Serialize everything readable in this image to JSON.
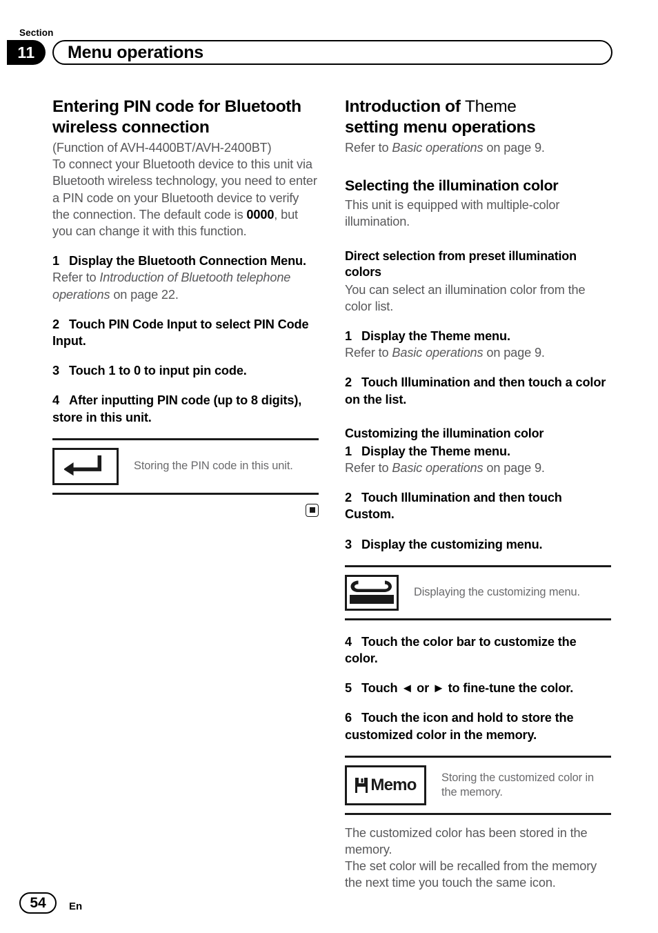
{
  "header": {
    "section_word": "Section",
    "section_number": "11",
    "title": "Menu operations"
  },
  "left_column": {
    "heading": "Entering PIN code for Bluetooth wireless connection",
    "intro_line1": "(Function of AVH-4400BT/AVH-2400BT)",
    "intro_line2_a": "To connect your Bluetooth device to this unit via Bluetooth wireless technology, you need to enter a PIN code on your Bluetooth device to verify the connection. The default code is ",
    "intro_bold": "0000",
    "intro_line2_b": ", but you can change it with this function.",
    "steps": [
      {
        "num": "1",
        "text": "Display the Bluetooth Connection Menu.",
        "ref_prefix": "Refer to ",
        "ref_italic": "Introduction of Bluetooth telephone operations",
        "ref_suffix": " on page 22."
      },
      {
        "num": "2",
        "text": "Touch PIN Code Input to select PIN Code Input."
      },
      {
        "num": "3",
        "text": "Touch 1 to 0 to input pin code."
      },
      {
        "num": "4",
        "text": "After inputting PIN code (up to 8 digits), store in this unit."
      }
    ],
    "note": {
      "icon": "enter-return-arrow-icon",
      "text": "Storing the PIN code in this unit."
    },
    "end_marker": "end-of-section-marker"
  },
  "right_column": {
    "heading_bold": "Introduction of ",
    "heading_regular": "Theme",
    "heading_line2": "setting menu operations",
    "heading_ref_prefix": "Refer to ",
    "heading_ref_italic": "Basic operations",
    "heading_ref_suffix": " on page 9.",
    "section1": {
      "heading": "Selecting the illumination color",
      "body": "This unit is equipped with multiple-color illumination."
    },
    "section2": {
      "heading": "Direct selection from preset illumination colors",
      "body": "You can select an illumination color from the color list.",
      "steps": [
        {
          "num": "1",
          "text": "Display the Theme menu.",
          "ref_prefix": "Refer to ",
          "ref_italic": "Basic operations",
          "ref_suffix": " on page 9."
        },
        {
          "num": "2",
          "text": "Touch Illumination and then touch a color on the list."
        }
      ]
    },
    "section3": {
      "heading": "Customizing the illumination color",
      "steps": [
        {
          "num": "1",
          "text": "Display the Theme menu.",
          "ref_prefix": "Refer to ",
          "ref_italic": "Basic operations",
          "ref_suffix": " on page 9."
        },
        {
          "num": "2",
          "text": "Touch Illumination and then touch Custom."
        },
        {
          "num": "3",
          "text": "Display the customizing menu."
        }
      ],
      "note_wrench": {
        "icon": "wrench-icon",
        "text": "Displaying the customizing menu."
      },
      "steps2": [
        {
          "num": "4",
          "text": "Touch the color bar to customize the color."
        },
        {
          "num": "5",
          "text": "Touch ◄ or ► to fine-tune the color."
        },
        {
          "num": "6",
          "text": "Touch the icon and hold to store the customized color in the memory."
        }
      ],
      "note_memo": {
        "icon": "memo-save-icon",
        "label": "Memo",
        "text": "Storing the customized color in the memory."
      },
      "closing": "The customized color has been stored in the memory.\nThe set color will be recalled from the memory the next time you touch the same icon."
    }
  },
  "footer": {
    "page_number": "54",
    "language": "En"
  }
}
